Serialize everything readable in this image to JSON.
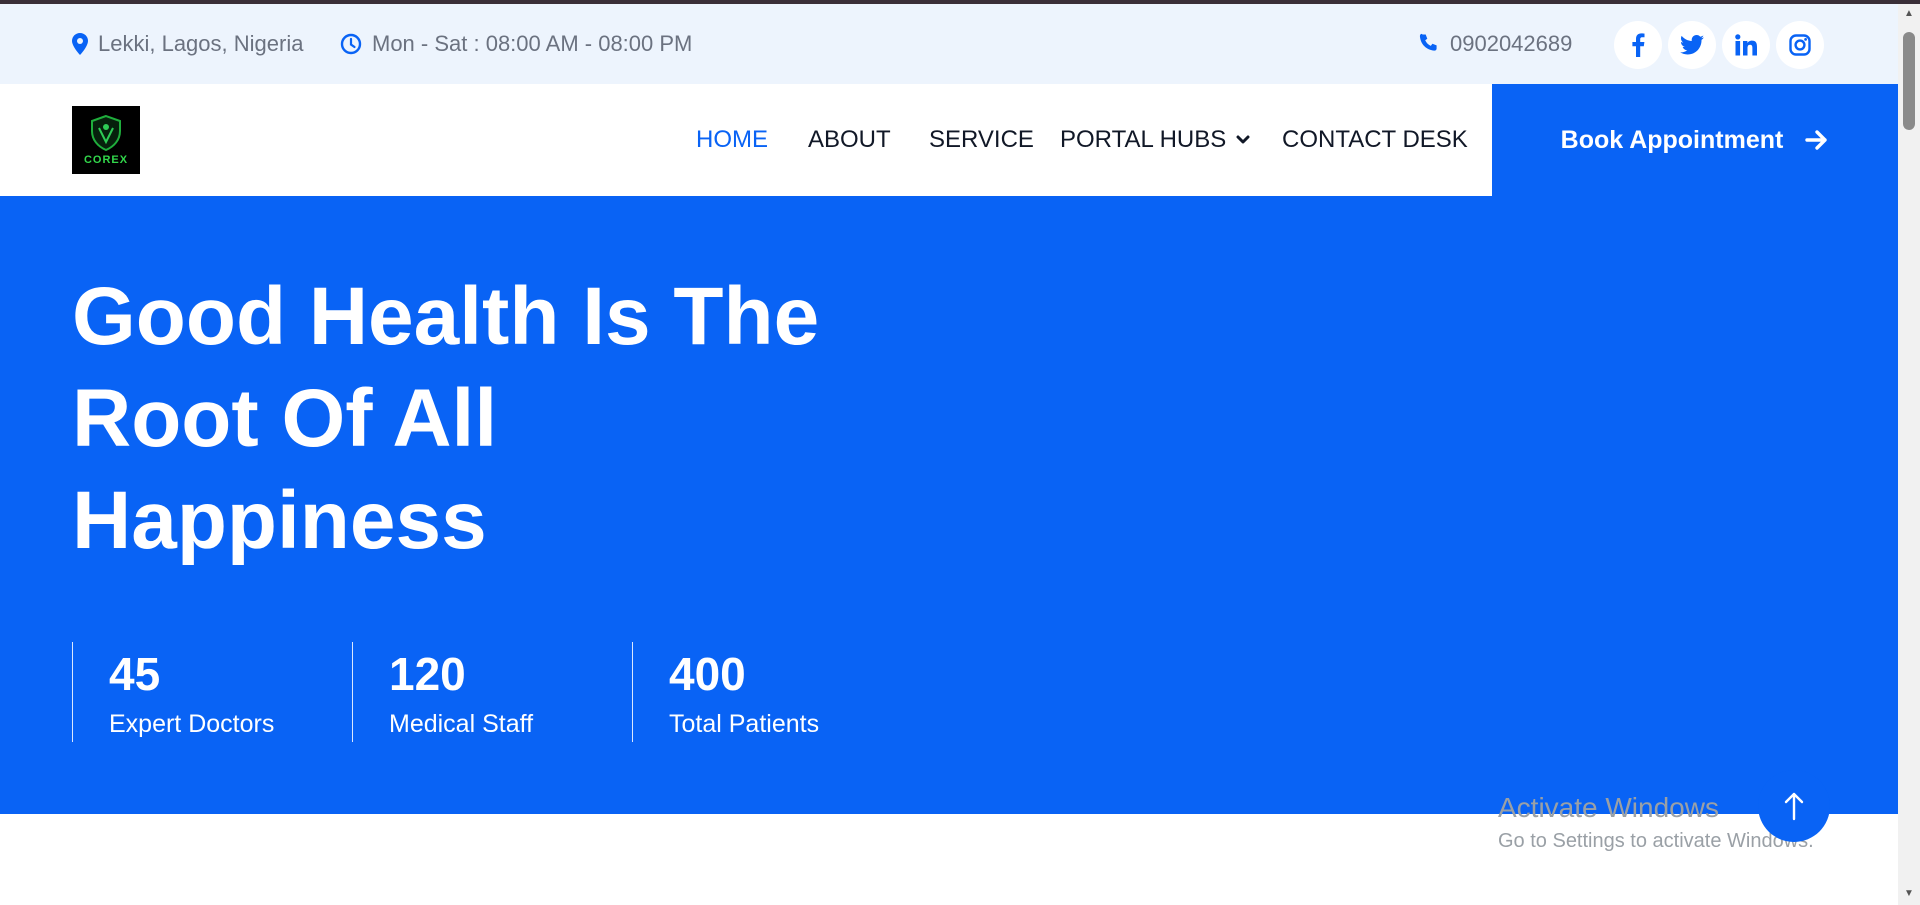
{
  "topbar": {
    "location": "Lekki, Lagos, Nigeria",
    "hours": "Mon - Sat : 08:00 AM - 08:00 PM",
    "phone": "0902042689",
    "socials": [
      "facebook-icon",
      "twitter-icon",
      "linkedin-icon",
      "instagram-icon"
    ]
  },
  "logo": {
    "text": "COREX"
  },
  "nav": {
    "items": [
      {
        "label": "HOME",
        "active": true
      },
      {
        "label": "ABOUT"
      },
      {
        "label": "SERVICE"
      },
      {
        "label": "PORTAL HUBS"
      },
      {
        "label": "CONTACT DESK"
      }
    ]
  },
  "cta": {
    "label": "Book Appointment"
  },
  "hero": {
    "title_lines": [
      "Good Health Is The",
      "Root Of All",
      "Happiness"
    ],
    "stats": [
      {
        "value": "45",
        "label": "Expert Doctors"
      },
      {
        "value": "120",
        "label": "Medical Staff"
      },
      {
        "value": "400",
        "label": "Total Patients"
      }
    ]
  },
  "watermark": {
    "title": "Activate Windows",
    "subtitle": "Go to Settings to activate Windows."
  },
  "colors": {
    "primary": "#0963f5",
    "topbar_bg": "#edf4fd",
    "text_dark": "#111827"
  }
}
